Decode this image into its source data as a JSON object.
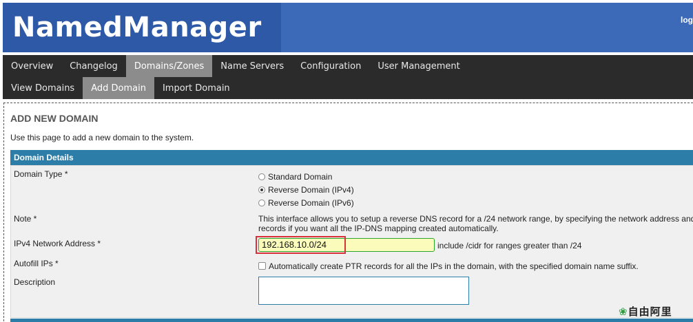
{
  "app": {
    "title": "NamedManager",
    "logout_label": "log"
  },
  "nav": {
    "primary": [
      {
        "label": "Overview",
        "active": false
      },
      {
        "label": "Changelog",
        "active": false
      },
      {
        "label": "Domains/Zones",
        "active": true
      },
      {
        "label": "Name Servers",
        "active": false
      },
      {
        "label": "Configuration",
        "active": false
      },
      {
        "label": "User Management",
        "active": false
      }
    ],
    "secondary": [
      {
        "label": "View Domains",
        "active": false
      },
      {
        "label": "Add Domain",
        "active": true
      },
      {
        "label": "Import Domain",
        "active": false
      }
    ]
  },
  "page": {
    "title": "ADD NEW DOMAIN",
    "description": "Use this page to add a new domain to the system."
  },
  "form": {
    "section_title": "Domain Details",
    "domain_type": {
      "label": "Domain Type *",
      "options": [
        {
          "label": "Standard Domain",
          "selected": false
        },
        {
          "label": "Reverse Domain (IPv4)",
          "selected": true
        },
        {
          "label": "Reverse Domain (IPv6)",
          "selected": false
        }
      ]
    },
    "note": {
      "label": "Note *",
      "line1": "This interface allows you to setup a reverse DNS record for a /24 network range, by specifying the network address and",
      "line2": "records if you want all the IP-DNS mapping created automatically."
    },
    "ipv4_network": {
      "label": "IPv4 Network Address *",
      "value": "192.168.10.0/24",
      "hint": "include /cidr for ranges greater than /24"
    },
    "autofill": {
      "label": "Autofill IPs *",
      "checkbox_label": "Automatically create PTR records for all the IPs in the domain, with the specified domain name suffix.",
      "checked": false
    },
    "description": {
      "label": "Description",
      "value": ""
    }
  },
  "watermark": {
    "icon": "leaf-icon",
    "text": "自由阿里"
  },
  "colors": {
    "banner": "#3c6ab8",
    "nav": "#2b2b2b",
    "nav_active": "#8c8c8c",
    "section_bar": "#2c7ea8",
    "input_bg": "#fbfbbb",
    "highlight": "#d9303a"
  }
}
